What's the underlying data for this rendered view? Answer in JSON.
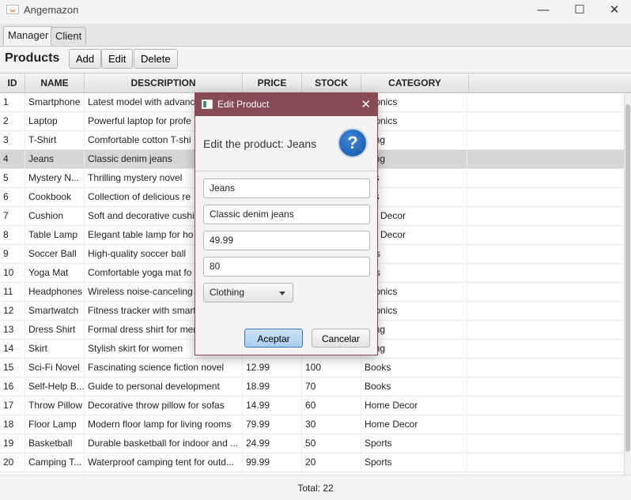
{
  "window": {
    "title": "Angemazon",
    "minimize": "—",
    "maximize": "☐",
    "close": "✕"
  },
  "tabs": [
    {
      "label": "Manager"
    },
    {
      "label": "Client"
    }
  ],
  "toolbar": {
    "title": "Products",
    "add_label": "Add",
    "edit_label": "Edit",
    "delete_label": "Delete"
  },
  "table": {
    "columns": [
      "ID",
      "NAME",
      "DESCRIPTION",
      "PRICE",
      "STOCK",
      "CATEGORY"
    ],
    "rows": [
      [
        "1",
        "Smartphone",
        "Latest model with advanc",
        "",
        "",
        "ctronics"
      ],
      [
        "2",
        "Laptop",
        "Powerful laptop for profe",
        "",
        "",
        "ctronics"
      ],
      [
        "3",
        "T-Shirt",
        "Comfortable cotton T-shi",
        "",
        "",
        "thing"
      ],
      [
        "4",
        "Jeans",
        "Classic denim jeans",
        "",
        "",
        "thing"
      ],
      [
        "5",
        "Mystery N...",
        "Thrilling mystery novel",
        "",
        "",
        "oks"
      ],
      [
        "6",
        "Cookbook",
        "Collection of delicious re",
        "",
        "",
        "oks"
      ],
      [
        "7",
        "Cushion",
        "Soft and decorative cushi",
        "",
        "",
        "me Decor"
      ],
      [
        "8",
        "Table Lamp",
        "Elegant table lamp for ho",
        "",
        "",
        "me Decor"
      ],
      [
        "9",
        "Soccer Ball",
        "High-quality soccer ball",
        "",
        "",
        "orts"
      ],
      [
        "10",
        "Yoga Mat",
        "Comfortable yoga mat fo",
        "",
        "",
        "orts"
      ],
      [
        "11",
        "Headphones",
        "Wireless noise-canceling",
        "",
        "",
        "ctronics"
      ],
      [
        "12",
        "Smartwatch",
        "Fitness tracker with smart",
        "",
        "",
        "ctronics"
      ],
      [
        "13",
        "Dress Shirt",
        "Formal dress shirt for men",
        "",
        "",
        "thing"
      ],
      [
        "14",
        "Skirt",
        "Stylish skirt for women",
        "",
        "",
        "thing"
      ],
      [
        "15",
        "Sci-Fi Novel",
        "Fascinating science fiction novel",
        "12.99",
        "100",
        "Books"
      ],
      [
        "16",
        "Self-Help B...",
        "Guide to personal development",
        "18.99",
        "70",
        "Books"
      ],
      [
        "17",
        "Throw Pillow",
        "Decorative throw pillow for sofas",
        "14.99",
        "60",
        "Home Decor"
      ],
      [
        "18",
        "Floor Lamp",
        "Modern floor lamp for living rooms",
        "79.99",
        "30",
        "Home Decor"
      ],
      [
        "19",
        "Basketball",
        "Durable basketball for indoor and ...",
        "24.99",
        "50",
        "Sports"
      ],
      [
        "20",
        "Camping T...",
        "Waterproof camping tent for outd...",
        "99.99",
        "20",
        "Sports"
      ]
    ],
    "selected_row_index": 3
  },
  "footer": {
    "total": "Total: 22"
  },
  "dialog": {
    "title": "Edit Product",
    "close": "✕",
    "header": "Edit the product: Jeans",
    "question_glyph": "?",
    "name_value": "Jeans",
    "description_value": "Classic denim jeans",
    "price_value": "49.99",
    "stock_value": "80",
    "category_value": "Clothing",
    "ok_label": "Aceptar",
    "cancel_label": "Cancelar"
  }
}
